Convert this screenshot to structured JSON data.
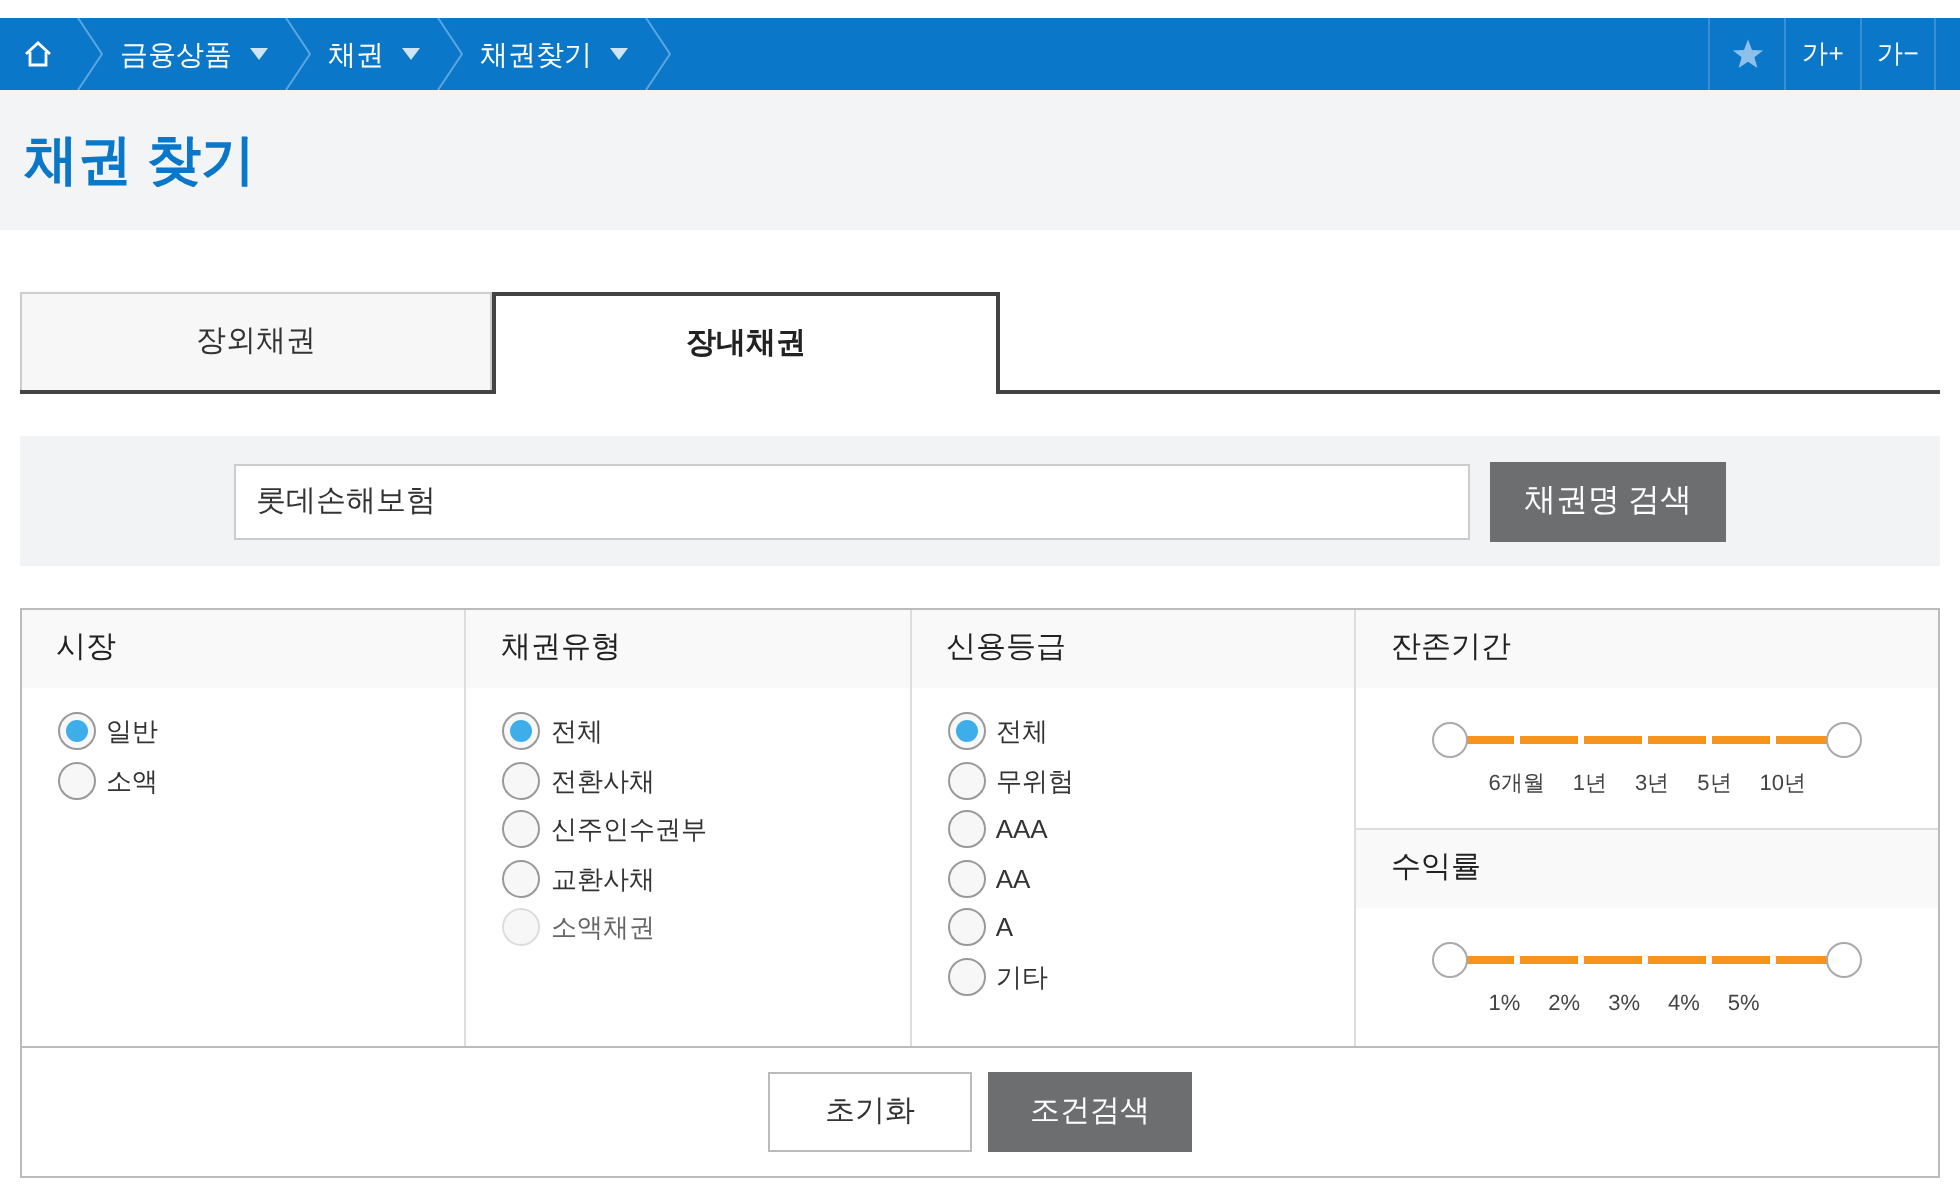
{
  "breadcrumb": [
    {
      "label": "금융상품"
    },
    {
      "label": "채권"
    },
    {
      "label": "채권찾기"
    }
  ],
  "toolbar": [
    {
      "kind": "star"
    },
    {
      "kind": "text",
      "label": "가+"
    },
    {
      "kind": "text",
      "label": "가−"
    }
  ],
  "page_title": "채권 찾기",
  "tabs": [
    {
      "label": "장외채권",
      "selected": false
    },
    {
      "label": "장내채권",
      "selected": true
    }
  ],
  "search": {
    "value": "롯데손해보험",
    "button": "채권명 검색"
  },
  "filters": [
    {
      "title": "시장",
      "options": [
        {
          "label": "일반",
          "selected": true,
          "disabled": false
        },
        {
          "label": "소액",
          "selected": false,
          "disabled": false
        }
      ]
    },
    {
      "title": "채권유형",
      "options": [
        {
          "label": "전체",
          "selected": true,
          "disabled": false
        },
        {
          "label": "전환사채",
          "selected": false,
          "disabled": false
        },
        {
          "label": "신주인수권부",
          "selected": false,
          "disabled": false
        },
        {
          "label": "교환사채",
          "selected": false,
          "disabled": false
        },
        {
          "label": "소액채권",
          "selected": false,
          "disabled": true
        }
      ]
    },
    {
      "title": "신용등급",
      "options": [
        {
          "label": "전체",
          "selected": true,
          "disabled": false
        },
        {
          "label": "무위험",
          "selected": false,
          "disabled": false
        },
        {
          "label": "AAA",
          "selected": false,
          "disabled": false
        },
        {
          "label": "AA",
          "selected": false,
          "disabled": false
        },
        {
          "label": "A",
          "selected": false,
          "disabled": false
        },
        {
          "label": "기타",
          "selected": false,
          "disabled": false
        }
      ]
    }
  ],
  "ranges": [
    {
      "title": "잔존기간",
      "thumbs": [
        {
          "level": 0
        },
        {
          "level": 1
        }
      ],
      "ticks": [
        "6개월",
        "1년",
        "3년",
        "5년",
        "10년"
      ]
    },
    {
      "title": "수익률",
      "thumbs": [
        {
          "level": 0
        },
        {
          "level": 1
        }
      ],
      "ticks": [
        "1%",
        "2%",
        "3%",
        "4%",
        "5%"
      ]
    }
  ],
  "buttons": [
    {
      "label": "초기화",
      "kind": "secondary"
    },
    {
      "label": "조건검색",
      "kind": "primary"
    }
  ]
}
